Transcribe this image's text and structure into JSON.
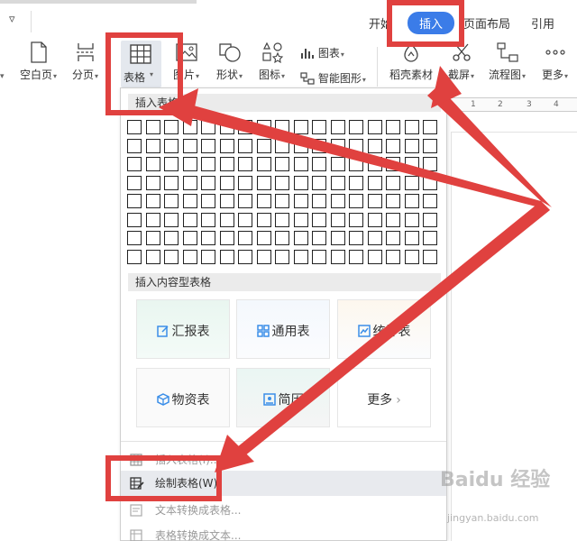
{
  "quick_access": {
    "dropdown_glyph": "▿"
  },
  "tabs": {
    "start": "开始",
    "insert": "插入",
    "layout": "页面布局",
    "reference": "引用"
  },
  "ribbon": {
    "blank_page": "空白页",
    "page_break": "分页",
    "table": "表格",
    "picture": "图片",
    "shape": "形状",
    "icon": "图标",
    "chart": "图表",
    "smart_graphic": "智能图形",
    "daoke_material": "稻壳素材",
    "screenshot": "截屏",
    "flowchart": "流程图",
    "more": "更多"
  },
  "ruler": {
    "n1": "1",
    "n2": "2",
    "n3": "3",
    "n4": "4"
  },
  "panel": {
    "insert_table_title": "插入表格",
    "content_table_title": "插入内容型表格",
    "cards": {
      "report": "汇报表",
      "general": "通用表",
      "statistics": "统计表",
      "materials": "物资表",
      "resume": "简历",
      "more": "更多"
    },
    "menu": {
      "insert_table": "插入表格(I)...",
      "draw_table": "绘制表格(W)",
      "text_to_table": "文本转换成表格...",
      "table_to_text": "表格转换成文本..."
    },
    "grid": {
      "rows": 8,
      "cols": 17
    }
  },
  "watermark": {
    "brand": "Baidu 经验",
    "url": "jingyan.baidu.com"
  },
  "colors": {
    "accent": "#3b7ce8",
    "annotation": "#e0413f"
  }
}
